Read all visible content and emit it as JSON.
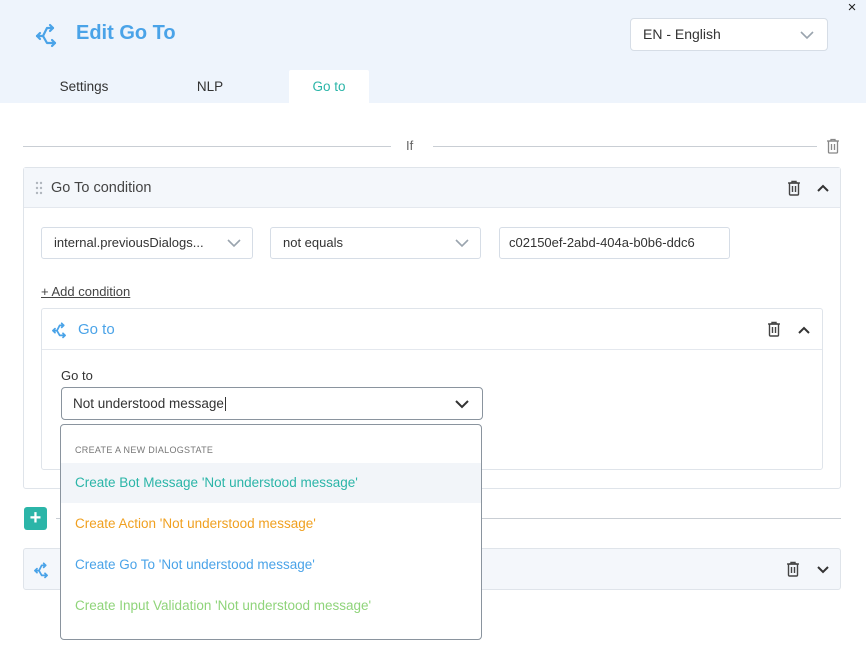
{
  "window": {
    "close_glyph": "×"
  },
  "header": {
    "title": "Edit Go To",
    "title_icon": "goto-arrows-icon",
    "language": {
      "selected": "EN - English"
    }
  },
  "tabs": [
    {
      "label": "Settings",
      "active": false
    },
    {
      "label": "NLP",
      "active": false
    },
    {
      "label": "Go to",
      "active": true
    }
  ],
  "if_section": {
    "label": "If"
  },
  "condition_card": {
    "title": "Go To condition",
    "variable": "internal.previousDialogs...",
    "operator": "not equals",
    "value": "c02150ef-2abd-404a-b0b6-ddc6",
    "add_condition_label": "+ Add condition"
  },
  "goto_card": {
    "title": "Go to",
    "field_label": "Go to",
    "input_value": "Not understood message"
  },
  "dropdown": {
    "header": "CREATE A NEW DIALOGSTATE",
    "options": [
      {
        "label": "Create Bot Message 'Not understood message'",
        "color": "#2bb5a8",
        "highlighted": true
      },
      {
        "label": "Create Action 'Not understood message'",
        "color": "#f0a020",
        "highlighted": false
      },
      {
        "label": "Create Go To 'Not understood message'",
        "color": "#4aa3e8",
        "highlighted": false
      },
      {
        "label": "Create Input Validation 'Not understood message'",
        "color": "#8fd47a",
        "highlighted": false
      }
    ]
  },
  "add_button": {
    "label": "+"
  },
  "colors": {
    "accent_teal": "#2bb5a8",
    "accent_blue": "#4aa3e8",
    "header_bg": "#eef4fc"
  }
}
